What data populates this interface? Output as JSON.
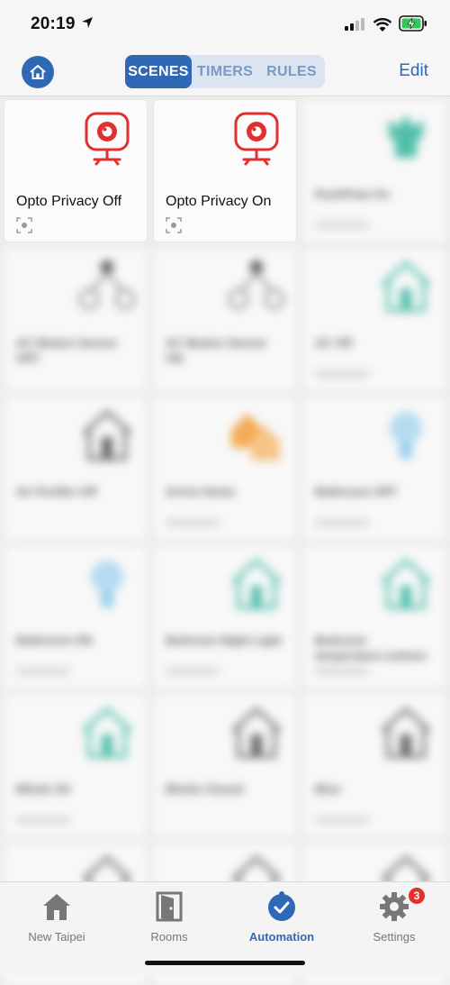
{
  "status_bar": {
    "time": "20:19"
  },
  "nav": {
    "tabs": [
      {
        "label": "SCENES",
        "active": true
      },
      {
        "label": "TIMERS",
        "active": false
      },
      {
        "label": "RULES",
        "active": false
      }
    ],
    "edit_label": "Edit"
  },
  "scenes": [
    {
      "title": "Opto Privacy Off",
      "icon": "camera-icon"
    },
    {
      "title": "Opto Privacy On",
      "icon": "camera-icon"
    },
    {
      "title": "PushFlow On",
      "icon": "plant-icon"
    },
    {
      "title": "AC Motion Sensor OFF",
      "icon": "network-icon"
    },
    {
      "title": "AC Motion Sensor ON",
      "icon": "network-icon"
    },
    {
      "title": "AC Off",
      "icon": "house-icon"
    },
    {
      "title": "Air Purifier Off",
      "icon": "house-icon"
    },
    {
      "title": "Arrive Home",
      "icon": "arrive-home-icon"
    },
    {
      "title": "Bathroom OFF",
      "icon": "bulb-icon"
    },
    {
      "title": "Bathroom ON",
      "icon": "bulb-icon"
    },
    {
      "title": "Bedroom Night Light",
      "icon": "house-icon"
    },
    {
      "title": "Bedroom temperature actions",
      "icon": "house-icon"
    },
    {
      "title": "Blinds Sit",
      "icon": "house-icon"
    },
    {
      "title": "Blinds Closed",
      "icon": "house-icon"
    },
    {
      "title": "Blue",
      "icon": "house-icon"
    },
    {
      "title": "",
      "icon": "house-icon"
    },
    {
      "title": "",
      "icon": "house-icon"
    },
    {
      "title": "",
      "icon": "house-icon"
    }
  ],
  "tabbar": {
    "items": [
      {
        "label": "New Taipei",
        "icon": "house-icon"
      },
      {
        "label": "Rooms",
        "icon": "door-icon"
      },
      {
        "label": "Automation",
        "icon": "automation-icon",
        "active": true
      },
      {
        "label": "Settings",
        "icon": "gear-icon"
      }
    ],
    "settings_badge": "3"
  },
  "colors": {
    "accent": "#2f68b4",
    "camera_red": "#e0302f",
    "teal": "#2bb39a",
    "orange": "#f59c31",
    "bulb_blue": "#7fc6ec"
  }
}
